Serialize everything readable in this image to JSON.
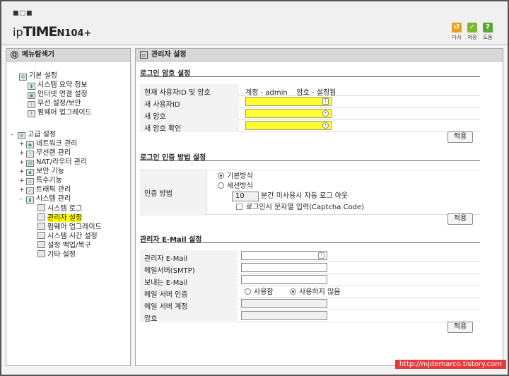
{
  "header": {
    "logo_squares": "■□■",
    "logo_brand_prefix": "ip",
    "logo_brand_main": "TIME",
    "logo_model": "N104+",
    "buttons": [
      {
        "label": "다시",
        "icon": "refresh-icon",
        "color": "#e8a020",
        "glyph": "↺"
      },
      {
        "label": "저장",
        "icon": "save-icon",
        "color": "#7ab830",
        "glyph": "✓"
      },
      {
        "label": "도움",
        "icon": "help-icon",
        "color": "#5aa830",
        "glyph": "?"
      }
    ]
  },
  "sidebar": {
    "title": "메뉴탐색기",
    "basic": {
      "label": "기본 설정",
      "items": [
        "시스템 요약 정보",
        "인터넷 연결 설정",
        "무선 설정/보안",
        "펌웨어 업그레이드"
      ]
    },
    "advanced": {
      "label": "고급 설정",
      "groups": [
        "네트워크 관리",
        "무선랜 관리",
        "NAT/라우터 관리",
        "보안 기능",
        "특수기능",
        "트래픽 관리",
        "시스템 관리"
      ],
      "system_items": [
        "시스템 로그",
        "관리자 설정",
        "펌웨어 업그레이드",
        "시스템 시간 설정",
        "설정 백업/복구",
        "기타 설정"
      ],
      "selected": "관리자 설정"
    }
  },
  "main": {
    "title": "관리자 설정",
    "login_section": {
      "title": "로그인 암호 설정",
      "current_label": "현재 사용자ID 및 암호",
      "current_value": "계정 - admin    암호 - 설정됨",
      "new_id_label": "새 사용자ID",
      "new_pw_label": "새 암호",
      "confirm_pw_label": "새 암호 확인",
      "apply": "적용"
    },
    "auth_section": {
      "title": "로그인 인증 방법 설정",
      "label": "인증 방법",
      "option_basic": "기본방식",
      "option_session": "세션방식",
      "session_minutes": "10",
      "session_text": "분간 미사용시 자동 로그 아웃",
      "captcha_text": "로그인시 문자열 입력(Captcha Code)",
      "apply": "적용"
    },
    "email_section": {
      "title": "관리자 E-Mail 설정",
      "admin_email_label": "관리자 E-Mail",
      "smtp_label": "메일서버(SMTP)",
      "sender_label": "보내는 E-Mail",
      "auth_label": "메일 서버 인증",
      "auth_use": "사용함",
      "auth_nouse": "사용하지 않음",
      "account_label": "메일 서버 계정",
      "password_label": "암호",
      "apply": "적용"
    }
  },
  "watermark": "http://mjdemarco.tistory.com"
}
